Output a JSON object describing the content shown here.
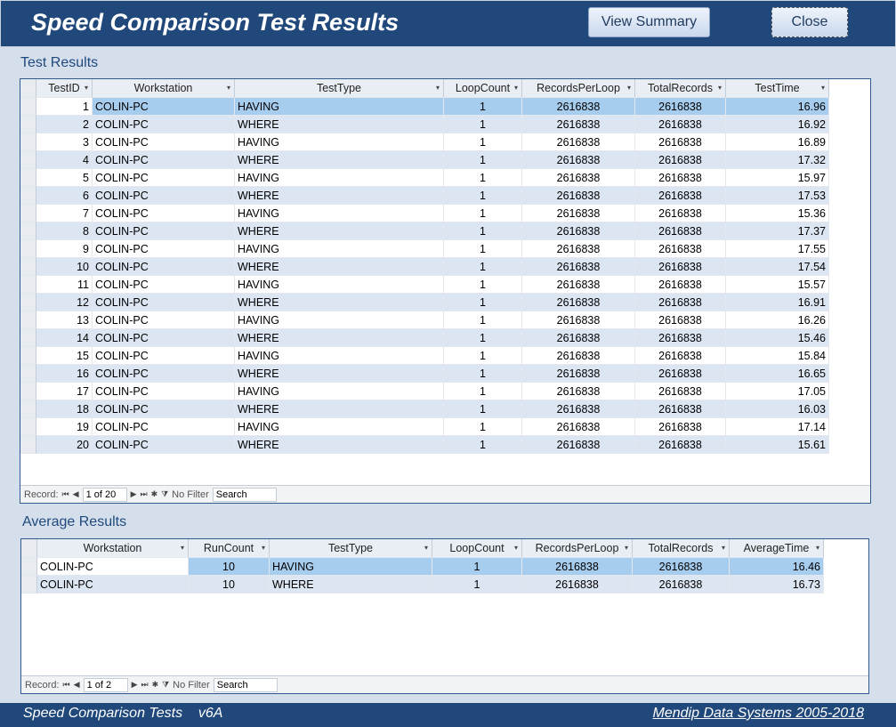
{
  "header": {
    "title": "Speed Comparison Test Results",
    "view_summary": "View Summary",
    "close": "Close"
  },
  "test_results": {
    "label": "Test Results",
    "columns": [
      "TestID",
      "Workstation",
      "TestType",
      "LoopCount",
      "RecordsPerLoop",
      "TotalRecords",
      "TestTime"
    ],
    "rows": [
      [
        1,
        "COLIN-PC",
        "HAVING",
        1,
        2616838,
        2616838,
        "16.96"
      ],
      [
        2,
        "COLIN-PC",
        "WHERE",
        1,
        2616838,
        2616838,
        "16.92"
      ],
      [
        3,
        "COLIN-PC",
        "HAVING",
        1,
        2616838,
        2616838,
        "16.89"
      ],
      [
        4,
        "COLIN-PC",
        "WHERE",
        1,
        2616838,
        2616838,
        "17.32"
      ],
      [
        5,
        "COLIN-PC",
        "HAVING",
        1,
        2616838,
        2616838,
        "15.97"
      ],
      [
        6,
        "COLIN-PC",
        "WHERE",
        1,
        2616838,
        2616838,
        "17.53"
      ],
      [
        7,
        "COLIN-PC",
        "HAVING",
        1,
        2616838,
        2616838,
        "15.36"
      ],
      [
        8,
        "COLIN-PC",
        "WHERE",
        1,
        2616838,
        2616838,
        "17.37"
      ],
      [
        9,
        "COLIN-PC",
        "HAVING",
        1,
        2616838,
        2616838,
        "17.55"
      ],
      [
        10,
        "COLIN-PC",
        "WHERE",
        1,
        2616838,
        2616838,
        "17.54"
      ],
      [
        11,
        "COLIN-PC",
        "HAVING",
        1,
        2616838,
        2616838,
        "15.57"
      ],
      [
        12,
        "COLIN-PC",
        "WHERE",
        1,
        2616838,
        2616838,
        "16.91"
      ],
      [
        13,
        "COLIN-PC",
        "HAVING",
        1,
        2616838,
        2616838,
        "16.26"
      ],
      [
        14,
        "COLIN-PC",
        "WHERE",
        1,
        2616838,
        2616838,
        "15.46"
      ],
      [
        15,
        "COLIN-PC",
        "HAVING",
        1,
        2616838,
        2616838,
        "15.84"
      ],
      [
        16,
        "COLIN-PC",
        "WHERE",
        1,
        2616838,
        2616838,
        "16.65"
      ],
      [
        17,
        "COLIN-PC",
        "HAVING",
        1,
        2616838,
        2616838,
        "17.05"
      ],
      [
        18,
        "COLIN-PC",
        "WHERE",
        1,
        2616838,
        2616838,
        "16.03"
      ],
      [
        19,
        "COLIN-PC",
        "HAVING",
        1,
        2616838,
        2616838,
        "17.14"
      ],
      [
        20,
        "COLIN-PC",
        "WHERE",
        1,
        2616838,
        2616838,
        "15.61"
      ]
    ],
    "nav": {
      "record_label": "Record:",
      "position": "1 of 20",
      "filter": "No Filter",
      "search": "Search"
    }
  },
  "average_results": {
    "label": "Average Results",
    "columns": [
      "Workstation",
      "RunCount",
      "TestType",
      "LoopCount",
      "RecordsPerLoop",
      "TotalRecords",
      "AverageTime"
    ],
    "rows": [
      [
        "COLIN-PC",
        10,
        "HAVING",
        1,
        2616838,
        2616838,
        "16.46"
      ],
      [
        "COLIN-PC",
        10,
        "WHERE",
        1,
        2616838,
        2616838,
        "16.73"
      ]
    ],
    "nav": {
      "record_label": "Record:",
      "position": "1 of 2",
      "filter": "No Filter",
      "search": "Search"
    }
  },
  "footer": {
    "left": "Speed Comparison Tests    v6A",
    "right": "Mendip Data Systems 2005-2018"
  }
}
